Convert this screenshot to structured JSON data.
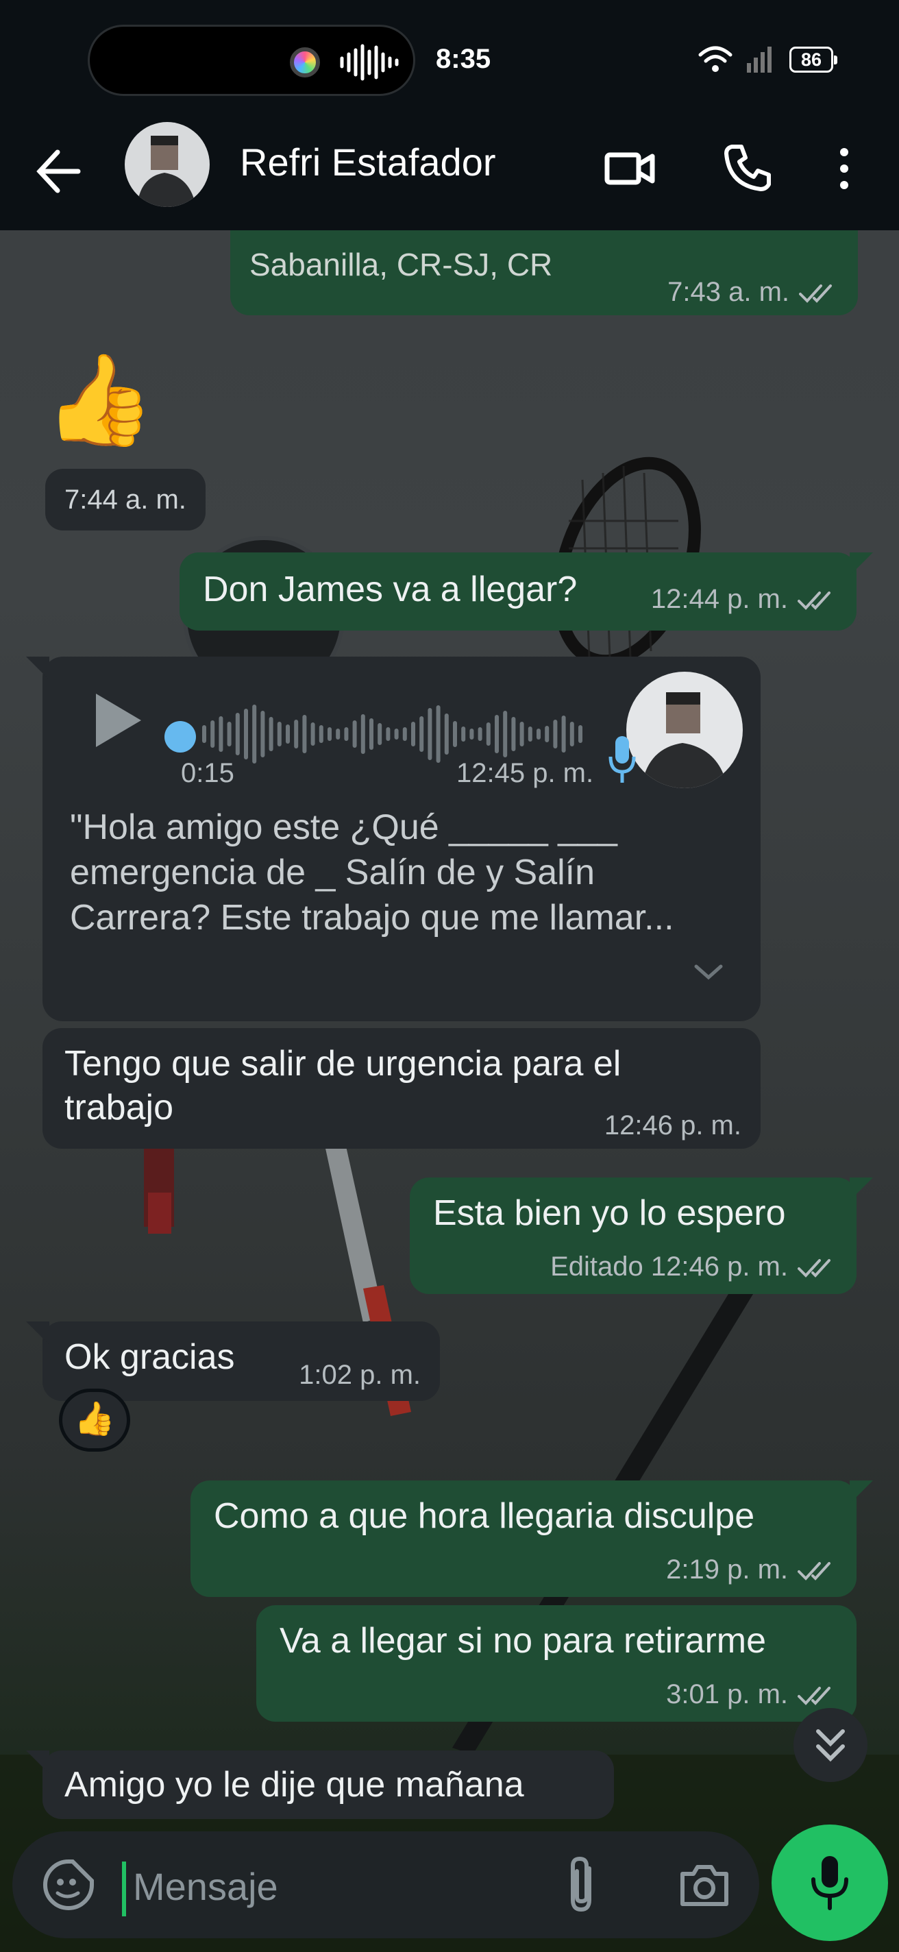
{
  "status_bar": {
    "time": "8:35",
    "battery": "86"
  },
  "header": {
    "contact_name": "Refri Estafador"
  },
  "messages": {
    "location_partial": {
      "text": "Sabanilla, CR-SJ, CR",
      "time": "7:43 a. m."
    },
    "thumbs_sticker": {
      "emoji": "👍",
      "time": "7:44 a. m."
    },
    "m1": {
      "text": "Don James va a llegar?",
      "time": "12:44 p. m."
    },
    "voice": {
      "duration": "0:15",
      "time": "12:45 p. m.",
      "transcript": "\"Hola amigo este ¿Qué _____ ___ emergencia de _ Salín de y Salín Carrera? Este trabajo que me llamar..."
    },
    "m2": {
      "text": "Tengo que salir de urgencia para el trabajo",
      "time": "12:46 p. m."
    },
    "m3": {
      "text": "Esta bien yo lo espero",
      "time": "Editado 12:46 p. m."
    },
    "m4": {
      "text": "Ok gracias",
      "time": "1:02 p. m.",
      "reaction": "👍"
    },
    "m5": {
      "text": "Como a que hora llegaria disculpe",
      "time": "2:19 p. m."
    },
    "m6": {
      "text": "Va a llegar si no para retirarme",
      "time": "3:01 p. m."
    },
    "m7": {
      "text": "Amigo yo le dije que mañana"
    }
  },
  "composer": {
    "placeholder": "Mensaje"
  },
  "colors": {
    "outgoing": "#1f4d34",
    "incoming": "#25292d",
    "accent": "#21c063",
    "tick": "#b5bcc0"
  }
}
